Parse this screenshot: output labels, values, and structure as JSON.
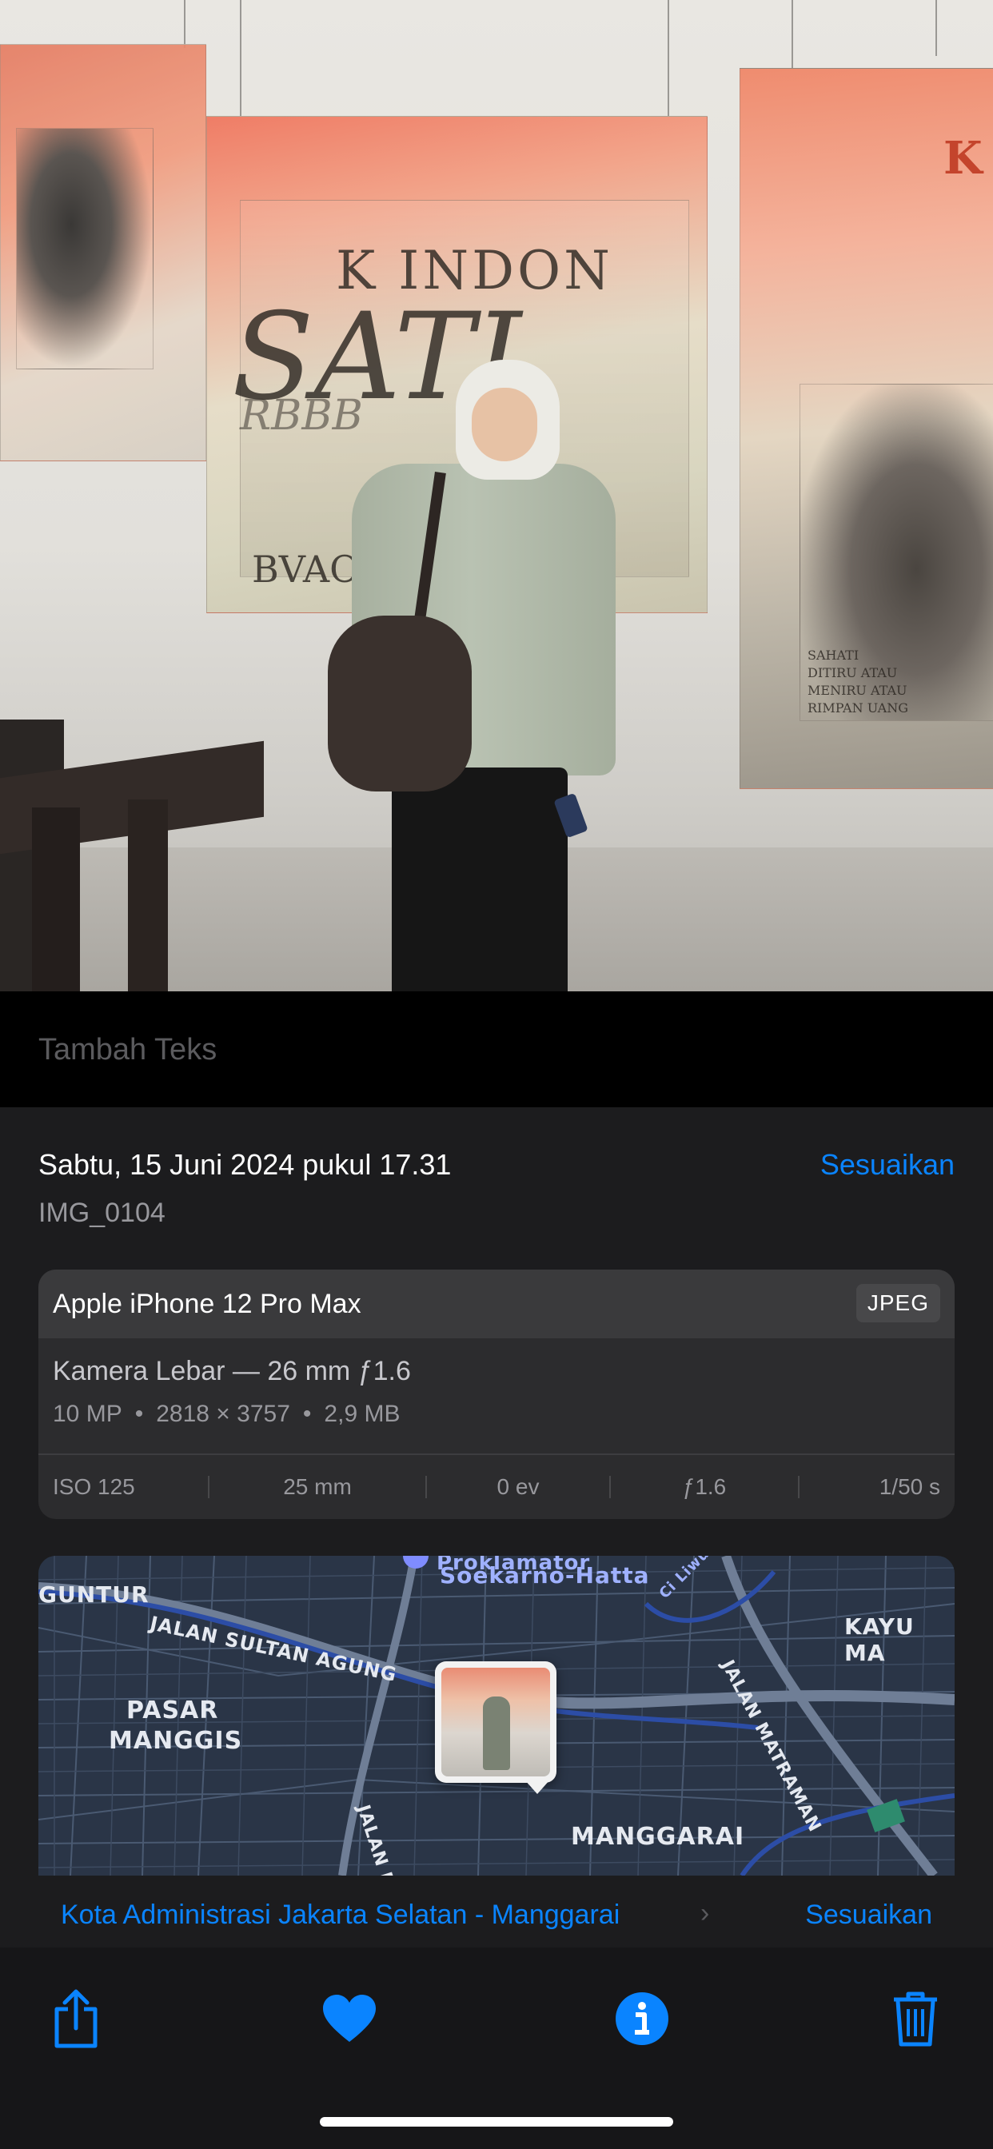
{
  "photo": {
    "panel_text": [
      "K INDON",
      "SATI",
      "RBBB",
      "BVAO",
      "K",
      "SAHATI",
      "DITIRU ATAU",
      "MENIRU ATAU",
      "RIMPAN UANG"
    ]
  },
  "caption": {
    "placeholder": "Tambah Teks"
  },
  "info": {
    "date": "Sabtu, 15 Juni 2024 pukul 17.31",
    "adjust_label": "Sesuaikan",
    "filename": "IMG_0104"
  },
  "camera": {
    "device": "Apple iPhone 12 Pro Max",
    "format": "JPEG",
    "lens": "Kamera Lebar — 26 mm ƒ1.6",
    "megapixels": "10 MP",
    "resolution": "2818 × 3757",
    "filesize": "2,9 MB",
    "exif": [
      "ISO 125",
      "25 mm",
      "0 ev",
      "ƒ1.6",
      "1/50 s"
    ]
  },
  "map": {
    "labels": {
      "monument": "Proklamator",
      "monument2": "Soekarno-Hatta",
      "guntur": "GUNTUR",
      "sultan": "JALAN SULTAN AGUNG",
      "matraman": "JALAN MATRAMAN",
      "kayu": "KAYU MA",
      "pasar": "PASAR",
      "manggis": "MANGGIS",
      "jalan_d": "JALAN D",
      "manggarai": "MANGGARAI",
      "ci": "Ci Liwu"
    }
  },
  "location": {
    "name": "Kota Administrasi Jakarta Selatan - Manggarai",
    "chevron": "›",
    "adjust_label": "Sesuaikan"
  },
  "colors": {
    "accent": "#0a84ff",
    "sheet": "#1c1c1e",
    "card": "#2c2c2e"
  },
  "toolbar": {
    "icons": [
      "share-icon",
      "heart-icon",
      "info-icon",
      "trash-icon"
    ]
  }
}
